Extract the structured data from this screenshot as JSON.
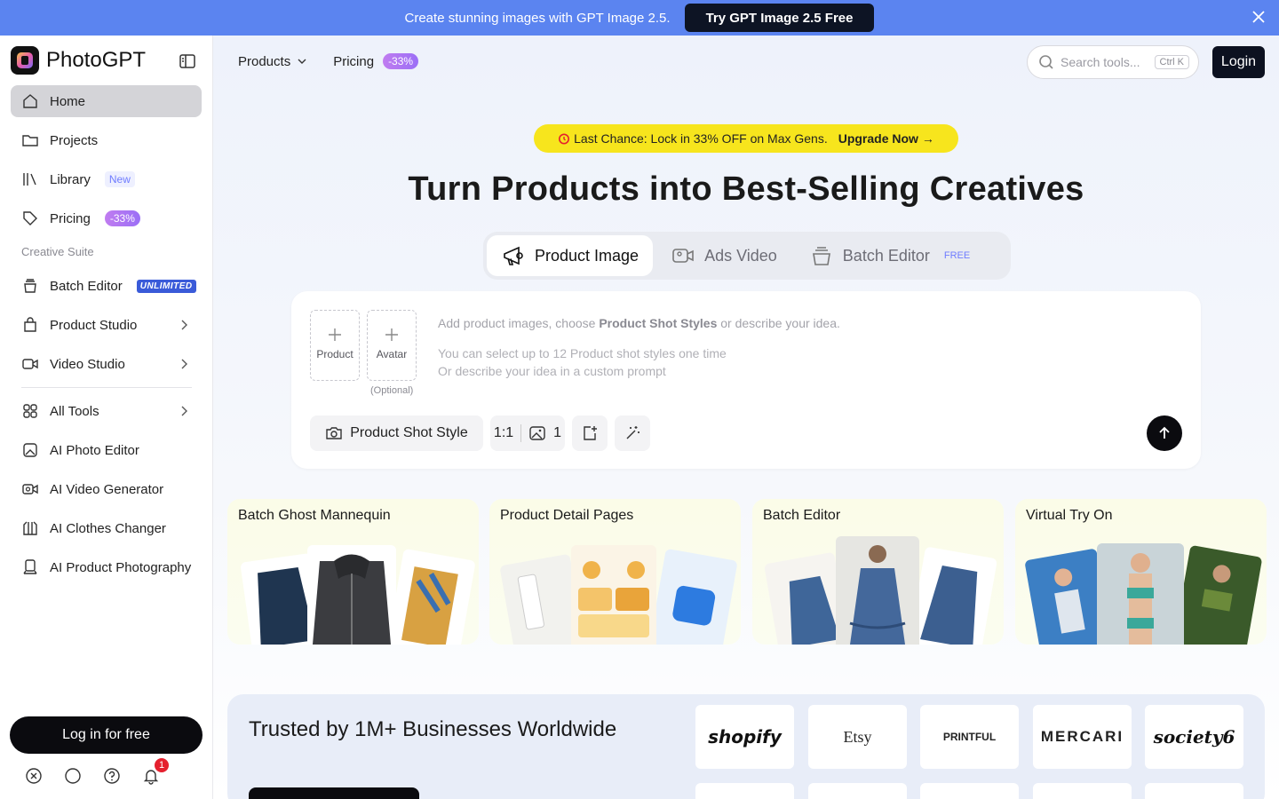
{
  "banner": {
    "text": "Create stunning images with GPT Image 2.5.",
    "cta": "Try GPT Image 2.5 Free"
  },
  "sidebar": {
    "brand": "PhotoGPT",
    "items": [
      {
        "label": "Home",
        "icon": "home-icon",
        "active": true
      },
      {
        "label": "Projects",
        "icon": "folder-icon"
      },
      {
        "label": "Library",
        "icon": "library-icon",
        "badge": "New"
      },
      {
        "label": "Pricing",
        "icon": "tag-icon",
        "badge": "-33%"
      }
    ],
    "section_label": "Creative Suite",
    "suite": [
      {
        "label": "Batch Editor",
        "icon": "stack-icon",
        "badge": "UNLIMITED"
      },
      {
        "label": "Product Studio",
        "icon": "bag-icon"
      },
      {
        "label": "Video Studio",
        "icon": "video-icon"
      }
    ],
    "tools": [
      {
        "label": "All Tools",
        "icon": "grid-icon"
      },
      {
        "label": "AI Photo Editor",
        "icon": "photo-edit-icon"
      },
      {
        "label": "AI Video Generator",
        "icon": "video-gen-icon"
      },
      {
        "label": "AI Clothes Changer",
        "icon": "clothes-icon"
      },
      {
        "label": "AI Product Photography",
        "icon": "product-photo-icon"
      }
    ],
    "login": "Log in for free",
    "notif_count": "1"
  },
  "topnav": {
    "products": "Products",
    "pricing": "Pricing",
    "pricing_badge": "-33%",
    "search_placeholder": "Search tools...",
    "search_kbd": "Ctrl K",
    "login": "Login"
  },
  "promo": {
    "text": "Last Chance: Lock in 33% OFF on Max Gens.",
    "cta": "Upgrade Now →"
  },
  "headline": "Turn Products into Best-Selling Creatives",
  "tabs": [
    {
      "label": "Product Image"
    },
    {
      "label": "Ads Video"
    },
    {
      "label": "Batch Editor",
      "badge": "FREE"
    }
  ],
  "composer": {
    "upload_product": "Product",
    "upload_avatar": "Avatar",
    "optional": "(Optional)",
    "hint_prefix": "Add product images, choose ",
    "hint_bold": "Product Shot Styles",
    "hint_suffix": " or describe your idea.",
    "hint_line2": "You can select up to 12 Product shot styles one time",
    "hint_line3": "Or describe your idea in a custom prompt",
    "style_btn": "Product Shot Style",
    "ratio": "1:1",
    "count": "1"
  },
  "cards": [
    "Batch Ghost Mannequin",
    "Product Detail Pages",
    "Batch Editor",
    "Virtual Try On"
  ],
  "trust": {
    "title": "Trusted by 1M+ Businesses Worldwide",
    "brands": [
      "shopify",
      "Etsy",
      "PRINTFUL",
      "MERCARI",
      "society6"
    ]
  }
}
